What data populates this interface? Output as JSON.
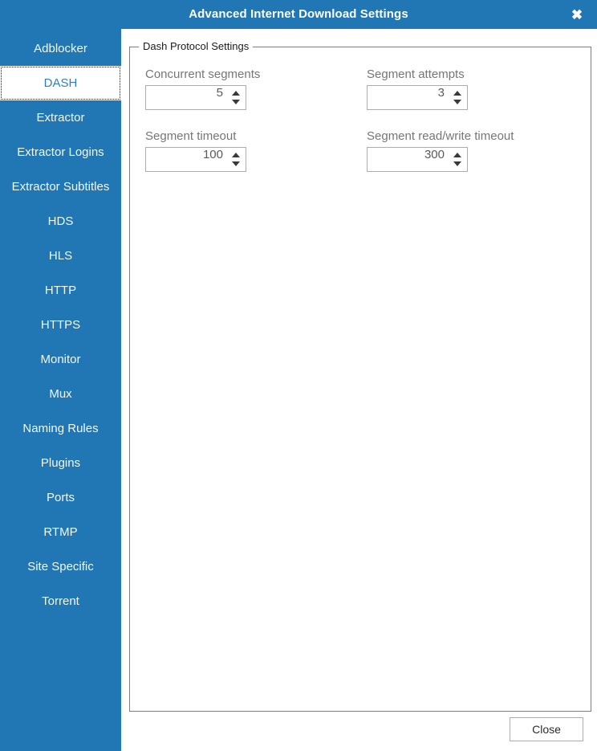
{
  "window": {
    "title": "Advanced Internet Download Settings",
    "close_icon": "close-x-icon",
    "accent_color": "#2077b4",
    "titlebar_text_color": "#ffffff"
  },
  "sidebar": {
    "selected": "DASH",
    "items": [
      {
        "label": "Adblocker",
        "selected": false
      },
      {
        "label": "DASH",
        "selected": true
      },
      {
        "label": "Extractor",
        "selected": false
      },
      {
        "label": "Extractor Logins",
        "selected": false
      },
      {
        "label": "Extractor Subtitles",
        "selected": false
      },
      {
        "label": "HDS",
        "selected": false
      },
      {
        "label": "HLS",
        "selected": false
      },
      {
        "label": "HTTP",
        "selected": false
      },
      {
        "label": "HTTPS",
        "selected": false
      },
      {
        "label": "Monitor",
        "selected": false
      },
      {
        "label": "Mux",
        "selected": false
      },
      {
        "label": "Naming Rules",
        "selected": false
      },
      {
        "label": "Plugins",
        "selected": false
      },
      {
        "label": "Ports",
        "selected": false
      },
      {
        "label": "RTMP",
        "selected": false
      },
      {
        "label": "Site Specific",
        "selected": false
      },
      {
        "label": "Torrent",
        "selected": false
      }
    ]
  },
  "main": {
    "groupbox_title": "Dash Protocol Settings",
    "fields": [
      {
        "label": "Concurrent segments",
        "value": "5",
        "name": "concurrent-segments"
      },
      {
        "label": "Segment attempts",
        "value": "3",
        "name": "segment-attempts"
      },
      {
        "label": "Segment timeout",
        "value": "100",
        "name": "segment-timeout"
      },
      {
        "label": "Segment read/write timeout",
        "value": "300",
        "name": "segment-read-write-timeout"
      }
    ]
  },
  "footer": {
    "close_label": "Close"
  }
}
